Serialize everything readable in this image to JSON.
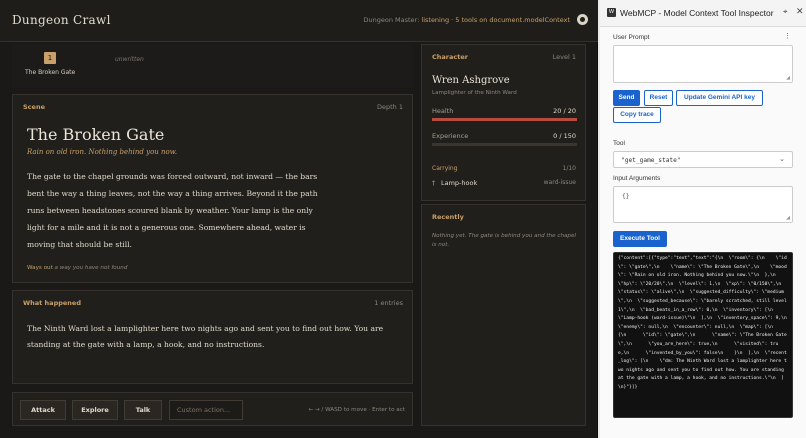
{
  "header": {
    "title": "Dungeon Crawl",
    "dm_label": "Dungeon Master:",
    "dm_status": "listening · 5 tools on document.modelContext"
  },
  "location": {
    "number": "1",
    "name": "The Broken Gate",
    "next": "unwritten"
  },
  "scene": {
    "label": "Scene",
    "depth": "Depth 1",
    "title": "The Broken Gate",
    "subtitle": "Rain on old iron. Nothing behind you now.",
    "body": "The gate to the chapel grounds was forced outward, not inward — the bars bent the way a thing leaves, not the way a thing arrives. Beyond it the path runs between headstones scoured blank by weather. Your lamp is the only light for a mile and it is not a generous one. Somewhere ahead, water is moving that should be still.",
    "ways_label": "Ways out",
    "ways_value": "a way you have not found"
  },
  "happened": {
    "label": "What happened",
    "count": "1 entries",
    "body": "The Ninth Ward lost a lamplighter here two nights ago and sent you to find out how. You are standing at the gate with a lamp, a hook, and no instructions."
  },
  "actions": {
    "attack": "Attack",
    "explore": "Explore",
    "talk": "Talk",
    "custom_placeholder": "Custom action...",
    "hint": "← → / WASD to move · Enter to act"
  },
  "character": {
    "label": "Character",
    "level": "Level 1",
    "name": "Wren Ashgrove",
    "title": "Lamplighter of the Ninth Ward",
    "health_label": "Health",
    "health_value": "20 / 20",
    "health_fraction": 1.0,
    "exp_label": "Experience",
    "exp_value": "0 / 150",
    "exp_fraction": 0.0,
    "carrying_label": "Carrying",
    "carrying_value": "1/10",
    "item_icon": "†",
    "item_name": "Lamp-hook",
    "item_tag": "ward-issue",
    "health_color": "#b84a3e",
    "exp_color": "#c9a06a"
  },
  "recent": {
    "label": "Recently",
    "body": "Nothing yet. The gate is behind you and the chapel is not."
  },
  "inspector": {
    "title": "WebMCP - Model Context Tool Inspector",
    "logo": "W",
    "user_prompt_label": "User Prompt",
    "send": "Send",
    "reset": "Reset",
    "update_key": "Update Gemini API key",
    "copy_trace": "Copy trace",
    "tool_label": "Tool",
    "tool_value": "\"get_game_state\"",
    "args_label": "Input Arguments",
    "args_value": "{}",
    "execute": "Execute Tool",
    "output": "{\"content\":[{\"type\":\"text\",\"text\":\"{\\n  \\\"room\\\": {\\n    \\\"id\\\": \\\"gate\\\",\\n    \\\"name\\\": \\\"The Broken Gate\\\",\\n    \\\"mood\\\": \\\"Rain on old iron. Nothing behind you now.\\\"\\n  },\\n  \\\"hp\\\": \\\"20/20\\\",\\n  \\\"level\\\": 1,\\n  \\\"xp\\\": \\\"0/150\\\",\\n  \\\"status\\\": \\\"alive\\\",\\n  \\\"suggested_difficulty\\\": \\\"medium\\\",\\n  \\\"suggested_because\\\": \\\"barely scratched, still level 1\\\",\\n  \\\"bad_beats_in_a_row\\\": 0,\\n  \\\"inventory\\\": [\\n    \\\"Lamp-hook (ward-issue)\\\"\\n  ],\\n  \\\"inventory_space\\\": 9,\\n  \\\"enemy\\\": null,\\n  \\\"encounter\\\": null,\\n  \\\"map\\\": [\\n    {\\n      \\\"id\\\": \\\"gate\\\",\\n      \\\"name\\\": \\\"The Broken Gate\\\",\\n      \\\"you_are_here\\\": true,\\n      \\\"visited\\\": true,\\n      \\\"invented_by_you\\\": false\\n    }\\n  ],\\n  \\\"recent_log\\\": [\\n    \\\"dm: The Ninth Ward lost a lamplighter here two nights ago and sent you to find out how. You are standing at the gate with a lamp, a hook, and no instructions.\\\"\\n  ]\\n}\"}]}"
  }
}
